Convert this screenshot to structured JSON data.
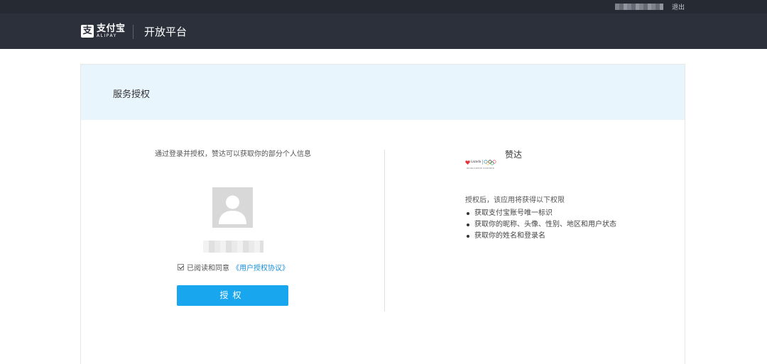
{
  "topbar": {
    "logout_label": "退出"
  },
  "header": {
    "logo_mark": "支",
    "logo_cn": "支付宝",
    "logo_en": "ALIPAY",
    "platform_title": "开放平台"
  },
  "card": {
    "title": "服务授权",
    "left": {
      "intro": "通过登录并授权，赞达可以获取你的部分个人信息",
      "agree_text": "已阅读和同意",
      "agreement_link": "《用户授权协议》",
      "agree_checked": true,
      "authorize_button": "授权"
    },
    "right": {
      "app_name": "赞达",
      "logo_brand": "Lazada",
      "logo_sub": "WORLDWIDE PARTNER",
      "permissions_title": "授权后，该应用将获得以下权限",
      "permissions": [
        "获取支付宝账号唯一标识",
        "获取你的昵称、头像、性别、地区和用户状态",
        "获取你的姓名和登录名"
      ]
    }
  },
  "colors": {
    "topbar_bg": "#262a33",
    "header_bg": "#2b303b",
    "card_head_bg": "#e9f5fd",
    "primary_button": "#18a6ee",
    "link": "#1a8fd8"
  },
  "icons": {
    "avatar": "default-user-avatar-icon",
    "checkbox": "checked-checkbox-icon"
  }
}
